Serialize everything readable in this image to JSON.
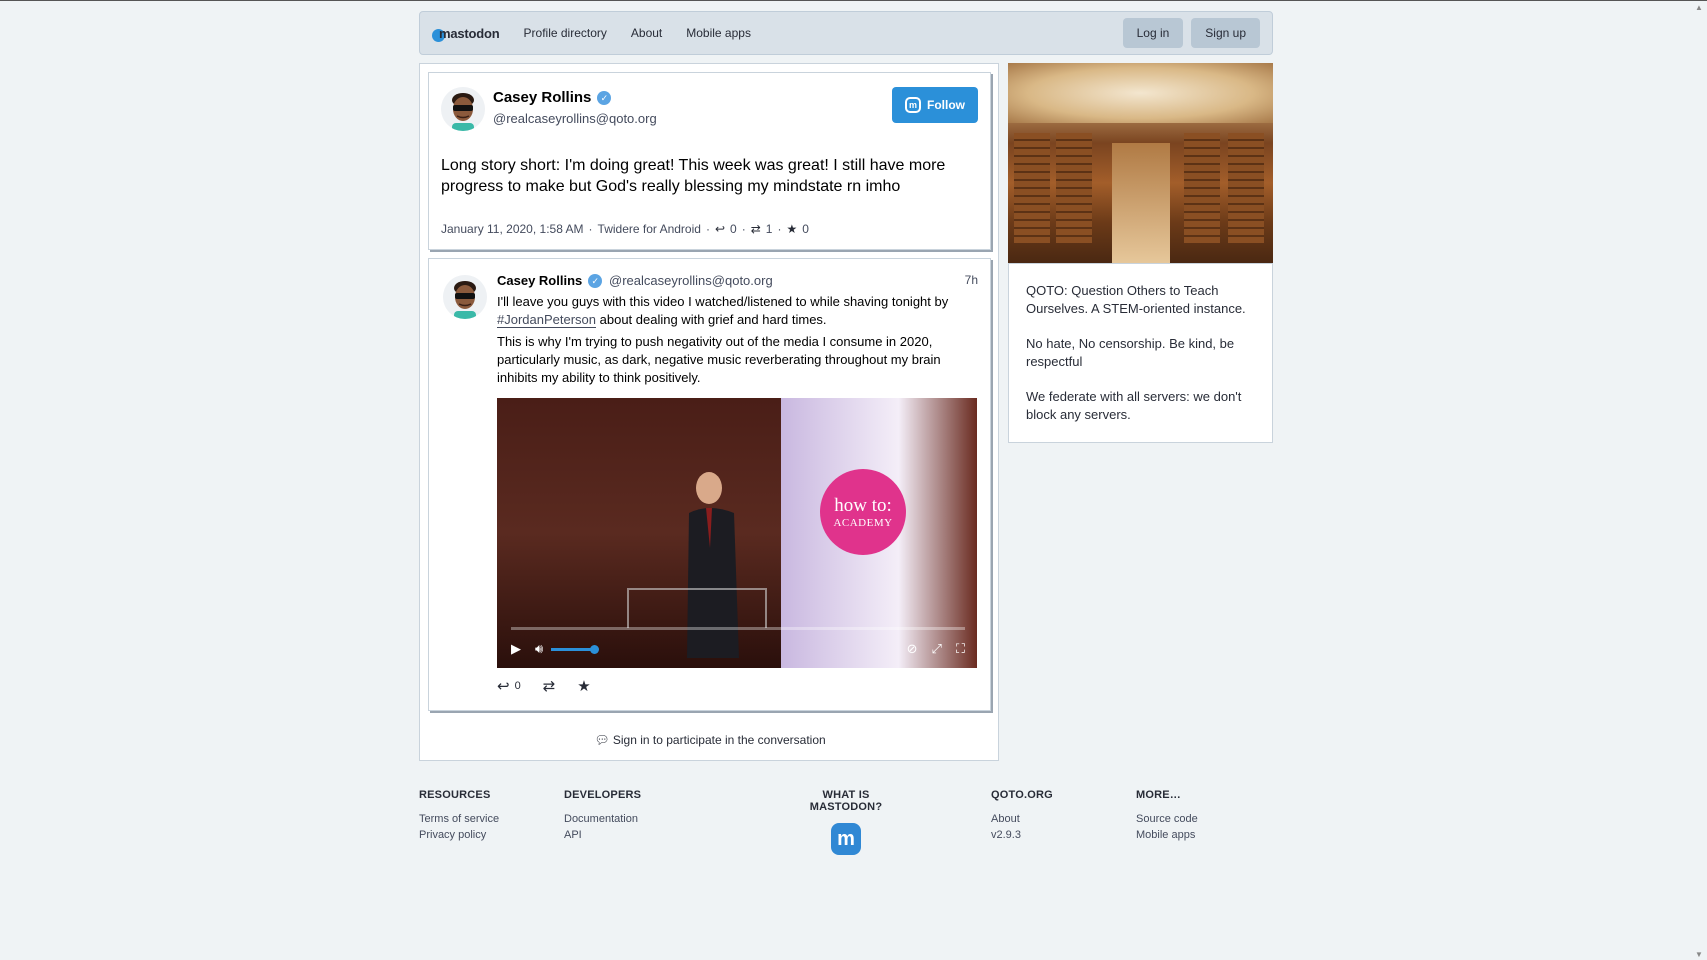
{
  "header": {
    "brand": "mastodon",
    "nav": [
      "Profile directory",
      "About",
      "Mobile apps"
    ],
    "login": "Log in",
    "signup": "Sign up"
  },
  "detailed_status": {
    "author_name": "Casey Rollins",
    "author_handle": "@realcaseyrollins@qoto.org",
    "follow_label": "Follow",
    "text": "Long story short: I'm doing great! This week was great! I still have more progress to make but God's really blessing my mindstate rn imho",
    "date": "January 11, 2020, 1:58 AM",
    "sep1": "·",
    "app": "Twidere for Android",
    "sep2": "·",
    "replies": "0",
    "sep3": "·",
    "boosts": "1",
    "sep4": "·",
    "favourites": "0"
  },
  "reply_status": {
    "author_name": "Casey Rollins",
    "author_handle": "@realcaseyrollins@qoto.org",
    "time": "7h",
    "para1_before": "I'll leave you guys with this video I watched/listened to while shaving tonight by ",
    "hashtag": "#JordanPeterson",
    "para1_after": " about dealing with grief and hard times.",
    "para2": "This is why I'm trying to push negativity out of the media I consume in 2020, particularly music, as dark, negative music reverberating throughout my brain inhibits my ability to think positively.",
    "video": {
      "logo_line1": "how to:",
      "logo_line2": "ACADEMY",
      "progress": 0.0,
      "volume": 1.0
    },
    "replies": "0"
  },
  "signin_text": "Sign in to participate in the conversation",
  "sidebar": {
    "paragraphs": [
      "QOTO: Question Others to Teach Ourselves. A STEM-oriented instance.",
      "No hate, No censorship. Be kind, be respectful",
      "We federate with all servers: we don't block any servers."
    ]
  },
  "footer": {
    "resources": {
      "title": "RESOURCES",
      "links": [
        "Terms of service",
        "Privacy policy"
      ]
    },
    "developers": {
      "title": "DEVELOPERS",
      "links": [
        "Documentation",
        "API"
      ]
    },
    "what": {
      "title": "WHAT IS MASTODON?"
    },
    "qoto": {
      "title": "QOTO.ORG",
      "links": [
        "About",
        "v2.9.3"
      ]
    },
    "more": {
      "title": "MORE…",
      "links": [
        "Source code",
        "Mobile apps"
      ]
    }
  },
  "colors": {
    "accent": "#2b90d9",
    "background": "#eff3f5",
    "header": "#d9e1e8"
  }
}
